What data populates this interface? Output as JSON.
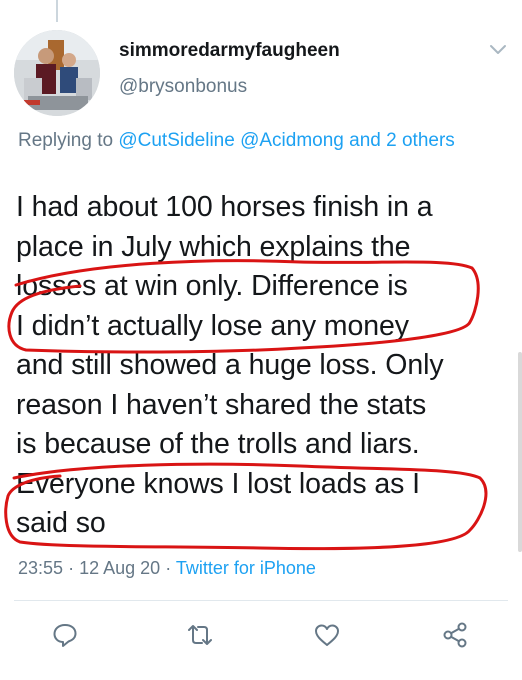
{
  "tweet": {
    "display_name": "simmoredarmyfaugheen",
    "handle": "@brysonbonus",
    "reply_prefix": "Replying to",
    "reply_mentions": "@CutSideline @Acidmong",
    "reply_and": "and",
    "reply_others": "2 others",
    "text_lines": [
      "I had about 100 horses finish in a",
      "place in July which explains the",
      "losses at win only. Difference is",
      "I didn’t actually lose any money",
      "and still showed a huge loss. Only",
      "reason I haven’t shared the stats",
      "is because of the trolls and liars.",
      "Everyone knows I lost loads as I",
      "said so"
    ],
    "time": "23:55",
    "separator": "·",
    "date": "12 Aug 20",
    "source": "Twitter for iPhone"
  },
  "actions": [
    "reply-icon",
    "retweet-icon",
    "like-icon",
    "share-icon"
  ],
  "colors": {
    "link": "#1da1f2",
    "secondary": "#657786",
    "annotation": "#d91414"
  }
}
